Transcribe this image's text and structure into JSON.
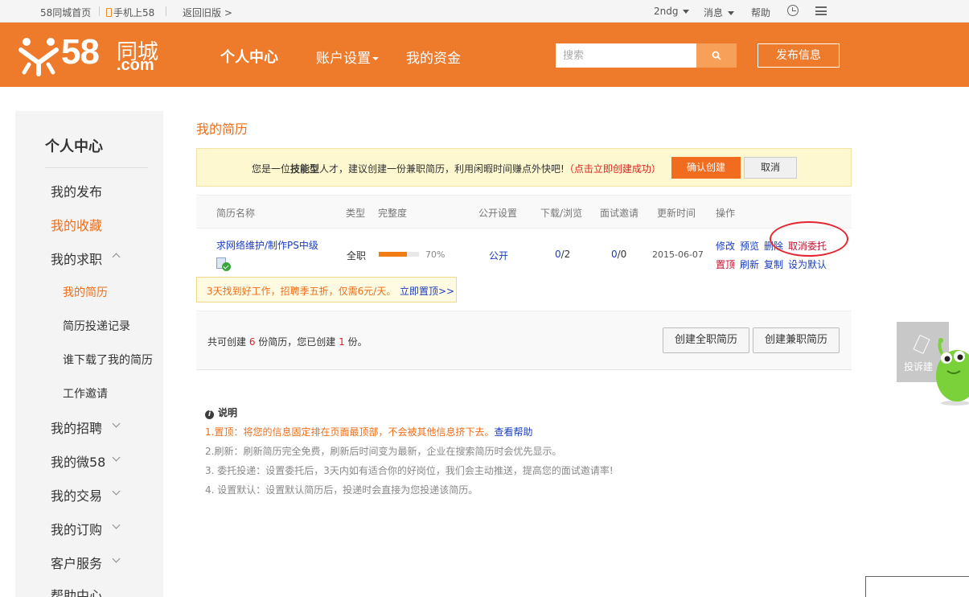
{
  "topbar": {
    "home_link": "58同城首页",
    "mobile_link": "手机上58",
    "old_version_link": "返回旧版 >",
    "username": "2ndg",
    "messages": "消息",
    "help": "帮助"
  },
  "header": {
    "logo_number": "58",
    "logo_cn": "同城",
    "logo_com": ".com",
    "nav": [
      "个人中心",
      "账户设置",
      "我的资金"
    ],
    "search_placeholder": "搜索",
    "post_button": "发布信息"
  },
  "sidebar": {
    "title": "个人中心",
    "items": [
      "我的发布",
      "我的收藏",
      "我的求职"
    ],
    "sub_items": [
      "我的简历",
      "简历投递记录",
      "谁下载了我的简历",
      "工作邀请"
    ],
    "more_items": [
      "我的招聘",
      "我的微58",
      "我的交易",
      "我的订购",
      "客户服务",
      "帮助中心"
    ]
  },
  "main": {
    "page_title": "我的简历",
    "notice": {
      "text_a": "您是一位",
      "text_bold": "技能型",
      "text_b": "人才，建议创建一份兼职简历，利用闲暇时间赚点外快吧!",
      "text_red": "（点击立即创建成功）",
      "confirm_button": "确认创建",
      "cancel_button": "取消"
    },
    "table_headers": [
      "简历名称",
      "类型",
      "完整度",
      "公开设置",
      "下载/浏览",
      "面试邀请",
      "更新时间",
      "操作"
    ],
    "resume": {
      "name": "求网络维护/制作PS中级",
      "type": "全职",
      "completeness": 70,
      "completeness_label": "70%",
      "visibility": "公开",
      "downloads": "0",
      "views": "/2",
      "invites": "0",
      "invites_suffix": "/0",
      "updated": "2015-06-07",
      "actions_row1": [
        "修改",
        "预览",
        "删除",
        "取消委托"
      ],
      "actions_row2": [
        "置顶",
        "刷新",
        "复制",
        "设为默认"
      ]
    },
    "promo": {
      "text": "3天找到好工作，招聘季五折，仅需6元/天。",
      "link": "立即置顶>>"
    },
    "summary": {
      "text_a": "共可创建 ",
      "max_count": "6",
      "text_b": " 份简历，您已创建 ",
      "created_count": "1",
      "text_c": " 份。",
      "btn_fulltime": "创建全职简历",
      "btn_parttime": "创建兼职简历"
    },
    "notes": {
      "title": "说明",
      "items": [
        "1.置顶：将您的信息固定排在页面最顶部，不会被其他信息挤下去。",
        "2.刷新：刷新简历完全免费，刷新后时间变为最新，企业在搜索简历时会优先显示。",
        "3. 委托投递：设置委托后，3天内如有适合你的好岗位，我们会主动推送，提高您的面试邀请率!",
        "4. 设置默认：设置默认简历后，投递时会直接为您投递该简历。"
      ],
      "help_link": "查看帮助"
    }
  },
  "feedback": {
    "label": "投诉建"
  },
  "colors": {
    "brand_orange": "#ee7b2c",
    "accent": "#ee6e1a",
    "link": "#1a3dbf",
    "alert": "#e3262f"
  },
  "icons": [
    "phone-icon",
    "clock-icon",
    "menu-icon",
    "search-icon",
    "resume-doc-icon",
    "chevron-icon",
    "pencil-icon",
    "mascot-icon"
  ]
}
